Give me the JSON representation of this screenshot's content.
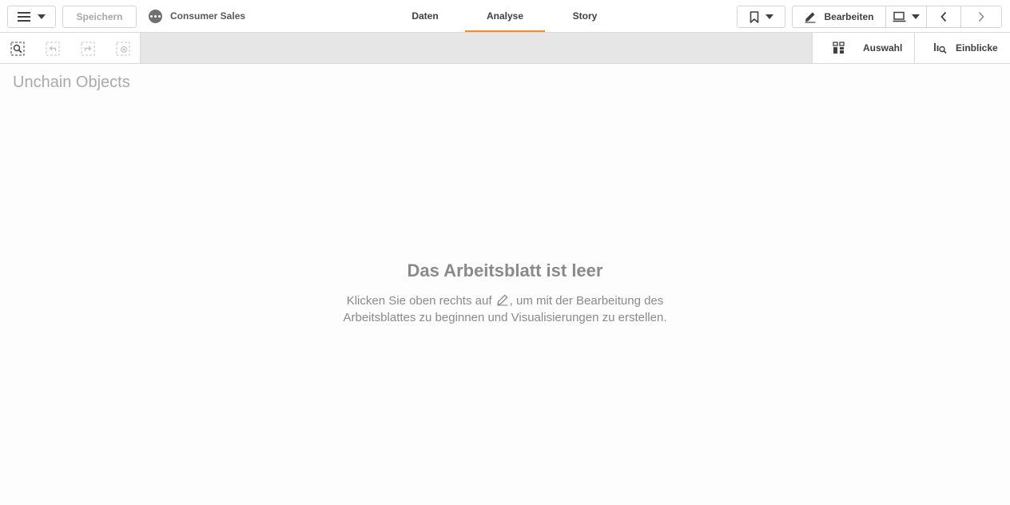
{
  "header": {
    "save_label": "Speichern",
    "app_name": "Consumer Sales",
    "tabs": [
      {
        "label": "Daten",
        "active": false
      },
      {
        "label": "Analyse",
        "active": true
      },
      {
        "label": "Story",
        "active": false
      }
    ],
    "edit_label": "Bearbeiten"
  },
  "toolbar": {
    "selections_label": "Auswahl",
    "insights_label": "Einblicke"
  },
  "sheet": {
    "title": "Unchain Objects",
    "empty_title": "Das Arbeitsblatt ist leer",
    "empty_desc_before": "Klicken Sie oben rechts auf",
    "empty_desc_after": ", um mit der Bearbeitung des Arbeitsblattes zu beginnen und Visualisierungen zu erstellen."
  },
  "colors": {
    "active_tab_accent": "#f28e20",
    "toolbar_bg": "#e6e6e6"
  },
  "icons": [
    "menu-icon",
    "app-options-icon",
    "bookmark-icon",
    "pencil-icon",
    "device-icon",
    "chevron-left-icon",
    "chevron-right-icon",
    "smart-search-icon",
    "step-back-icon",
    "step-forward-icon",
    "clear-selections-icon",
    "selections-grid-icon",
    "insights-icon"
  ]
}
